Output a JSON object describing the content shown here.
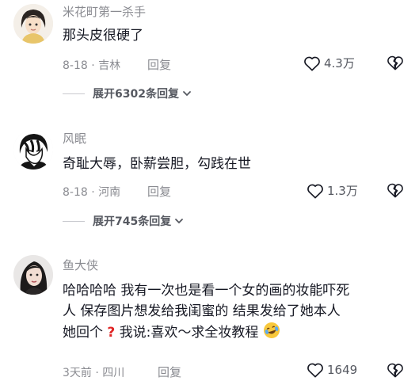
{
  "comments": [
    {
      "username": "米花町第一杀手",
      "text": "那头皮很硬了",
      "date": "8-18",
      "location": "吉林",
      "reply_label": "回复",
      "likes": "4.3万",
      "expand_label": "展开6302条回复"
    },
    {
      "username": "风眠",
      "text": "奇耻大辱，卧薪尝胆，勾践在世",
      "date": "8-18",
      "location": "河南",
      "reply_label": "回复",
      "likes": "1.3万",
      "expand_label": "展开745条回复"
    },
    {
      "username": "鱼大侠",
      "text_line1": "哈哈哈哈 我有一次也是看一个女的画的妆能吓死",
      "text_line2": "人 保存图片想发给我闺蜜的 结果发给了她本人",
      "text_line3a": "她回个",
      "text_line3b": "我说:喜欢～求全妆教程",
      "date": "3天前",
      "location": "四川",
      "reply_label": "回复",
      "likes": "1649"
    }
  ],
  "separator": "·",
  "icons": {
    "like": "heart-outline-icon",
    "dislike": "broken-heart-icon",
    "expand": "chevron-down-icon",
    "question": "red-question-mark-emoji",
    "laughing": "laughing-crying-emoji"
  }
}
